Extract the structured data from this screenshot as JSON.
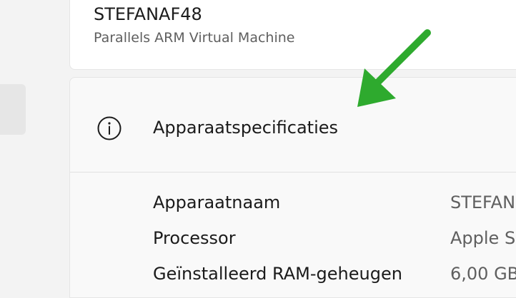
{
  "device": {
    "name": "STEFANAF48",
    "model": "Parallels ARM Virtual Machine"
  },
  "specs": {
    "title": "Apparaatspecificaties",
    "icon": "info-icon",
    "rows": [
      {
        "label": "Apparaatnaam",
        "value": "STEFAN"
      },
      {
        "label": "Processor",
        "value": "Apple S"
      },
      {
        "label": "Geïnstalleerd RAM-geheugen",
        "value": "6,00 GB"
      }
    ]
  },
  "annotation": {
    "arrow_color": "#2eaa2e"
  }
}
